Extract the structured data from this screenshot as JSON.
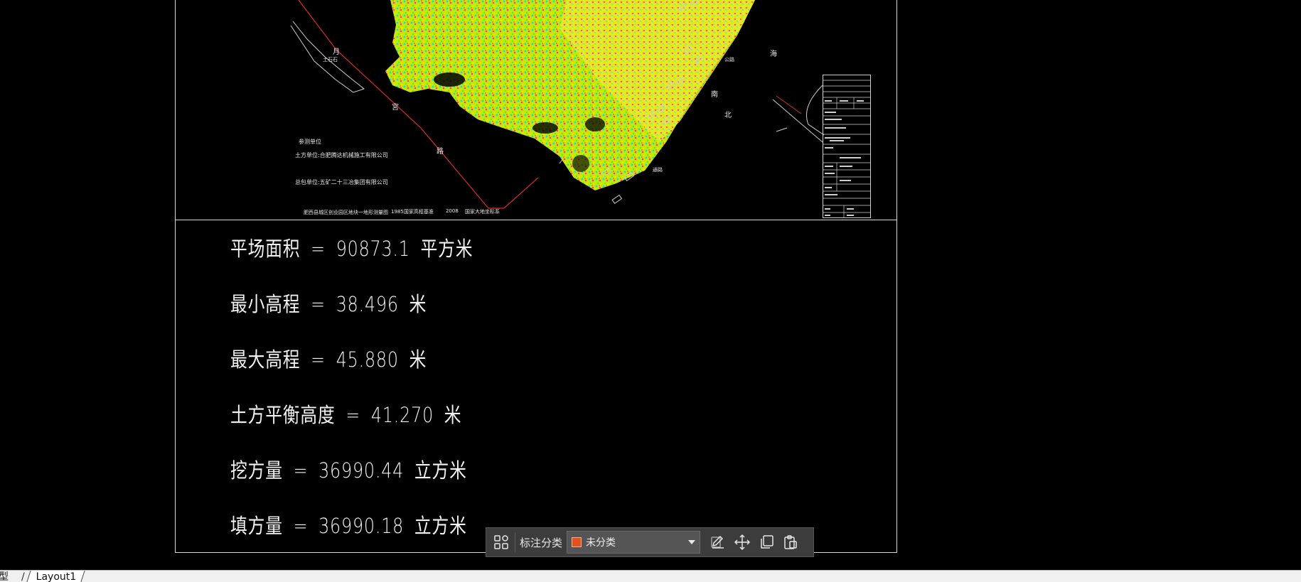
{
  "drawing": {
    "labels": {
      "yue": "月",
      "mark_small": "土石石",
      "gong": "宮",
      "lu": "路",
      "nan": "南",
      "bei": "北",
      "hai": "海",
      "road_tag_1": "公路",
      "road_tag_2": "通路",
      "section_title": "参测单位",
      "contractor_line": "土方单位:合肥腾达机械施工有限公司",
      "owner_line": "总包单位:五矿二十三冶集团有限公司",
      "footer_left": "肥西县城区创业园区地块一地形测量图",
      "footer_mid": "1985国家高程基准",
      "footer_year": "2008",
      "footer_right": "国家大地坐标系"
    }
  },
  "results": [
    {
      "label": "平场面积",
      "eq": "=",
      "value": "90873.1",
      "unit": "平方米"
    },
    {
      "label": "最小高程",
      "eq": "=",
      "value": "38.496",
      "unit": "米"
    },
    {
      "label": "最大高程",
      "eq": "=",
      "value": "45.880",
      "unit": "米"
    },
    {
      "label": "土方平衡高度",
      "eq": "=",
      "value": "41.270",
      "unit": "米"
    },
    {
      "label": "挖方量",
      "eq": "=",
      "value": "36990.44",
      "unit": "立方米"
    },
    {
      "label": "填方量",
      "eq": "=",
      "value": "36990.18",
      "unit": "立方米"
    }
  ],
  "toolbar": {
    "label": "标注分类",
    "category_selected": "未分类",
    "category_color": "#e0521e",
    "icons": [
      "grid-icon",
      "edit-icon",
      "move-icon",
      "copy-icon",
      "paste-icon"
    ]
  },
  "tabs": {
    "model": "型",
    "layout1": "Layout1"
  }
}
